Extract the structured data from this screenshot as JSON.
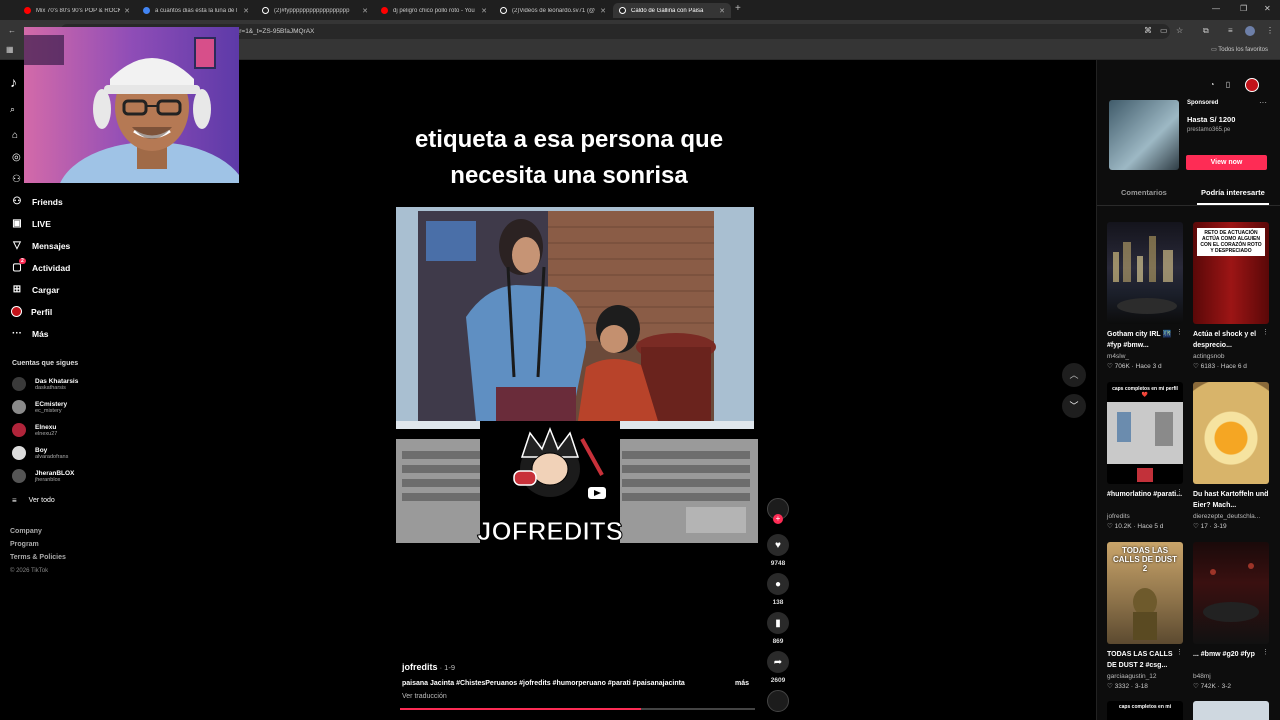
{
  "browser": {
    "tabs": [
      {
        "label": "Mix 70's 80's 90's POP & ROCK",
        "color": "#ff0000"
      },
      {
        "label": "a cuantos dias esta la luna de l",
        "color": "#4285f4"
      },
      {
        "label": "(2)#fypppppppppppppppppp",
        "color": "#ffffff"
      },
      {
        "label": "dj peligro chico pollo roto - You",
        "color": "#ff0000"
      },
      {
        "label": "(2)Videos de leonardo.sv71 (@",
        "color": "#ffffff"
      },
      {
        "label": "Caldo de Gallina con Paisa",
        "color": "#ffffff"
      }
    ],
    "url": "?_r=1&_t=ZS-95BfaJMQrAX",
    "bookmarks_all": "Todos los favoritos"
  },
  "sidebar": {
    "nav": [
      {
        "label": "Friends",
        "icon": "friends-icon"
      },
      {
        "label": "LIVE",
        "icon": "live-icon"
      },
      {
        "label": "Mensajes",
        "icon": "messages-icon"
      },
      {
        "label": "Actividad",
        "icon": "activity-icon",
        "badge": "2"
      },
      {
        "label": "Cargar",
        "icon": "upload-icon"
      },
      {
        "label": "Perfil",
        "icon": "profile-icon"
      },
      {
        "label": "Más",
        "icon": "more-icon"
      }
    ],
    "following_title": "Cuentas que sigues",
    "following": [
      {
        "name": "Das Khatarsis",
        "handle": "daskatharsis",
        "color": "#3a3a3a"
      },
      {
        "name": "ECmistery",
        "handle": "ec_mistery",
        "color": "#8a8a8a"
      },
      {
        "name": "Elnexu",
        "handle": "elnexu27",
        "color": "#b0243a"
      },
      {
        "name": "Boy",
        "handle": "alvaradofrans",
        "color": "#dcdcdc"
      },
      {
        "name": "JheranBLOX",
        "handle": "jheranblox",
        "color": "#555555"
      }
    ],
    "see_all": "Ver todo",
    "footer": [
      "Company",
      "Program",
      "Terms & Policies"
    ],
    "copyright": "© 2026 TikTok"
  },
  "video": {
    "caption_line1": "etiqueta a esa persona que",
    "caption_line2": "necesita una sonrisa",
    "watermark": "JOFREDITS",
    "author": "jofredits",
    "date": " · 1-9",
    "description": "paisana Jacinta #ChistesPeruanos #jofredits #humorperuano #parati #paisanajacinta",
    "more": "más",
    "translate": "Ver traducción",
    "progress": 0.68,
    "likes": "9748",
    "comments": "138",
    "saves": "869",
    "shares": "2609"
  },
  "right_panel": {
    "ad": {
      "sponsored": "Sponsored",
      "title": "Hasta S/ 1200",
      "domain": "prestamo365.pe",
      "cta": "View now"
    },
    "tabs": [
      "Comentarios",
      "Podría interesarte"
    ],
    "cards": [
      {
        "title": "Gotham city IRL 🌃 #fyp #bmw...",
        "user": "m4slw_",
        "stats": "♡ 706K · Hace 3 d"
      },
      {
        "title": "Actúa el shock y el desprecio...",
        "user": "actingsnob",
        "stats": "♡ 6183 · Hace 6 d",
        "overlay": "RETO DE ACTUACIÓN ACTÚA COMO ALGUIEN CON EL CORAZÓN ROTO Y DESPRECIADO"
      },
      {
        "title": "#humorlatino #parati...",
        "user": "jofredits",
        "stats": "♡ 10.2K · Hace 5 d",
        "overlay": "caps completos en mi perfil ❤️"
      },
      {
        "title": "Du hast Kartoffeln und Eier? Mach...",
        "user": "dierezepte_deutschla...",
        "stats": "♡ 17 · 3-19"
      },
      {
        "title": "TODAS LAS CALLS DE DUST 2 #csg...",
        "user": "garciaagustin_12",
        "stats": "♡ 3332 · 3-18",
        "overlay": "TODAS LAS CALLS DE DUST 2"
      },
      {
        "title": "... #bmw #g20 #fyp",
        "user": "b48mj",
        "stats": "♡ 742K · 3-2"
      }
    ],
    "next_overlay": "caps completos en mi"
  }
}
